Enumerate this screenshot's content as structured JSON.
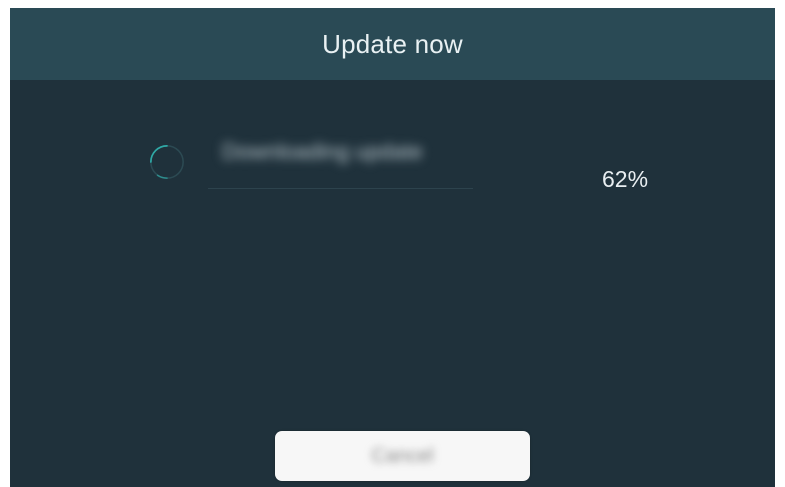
{
  "dialog": {
    "title": "Update now",
    "status_text": "Downloading update",
    "progress_percent": 62,
    "progress_label": "62%",
    "cancel_label": "Cancel"
  },
  "colors": {
    "background": "#1f313b",
    "header": "#2a4a55",
    "spinner_accent": "#2fa9a6",
    "button": "#f7f7f7"
  },
  "icons": {
    "spinner": "loading-spinner-icon"
  }
}
